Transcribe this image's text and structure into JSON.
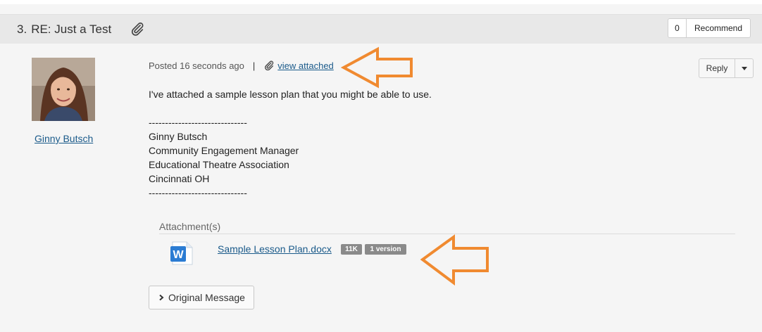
{
  "thread": {
    "number": "3.",
    "title": "RE: Just a Test",
    "recommend_count": "0",
    "recommend_label": "Recommend"
  },
  "author": {
    "name": "Ginny Butsch",
    "avatar_icon": "profile-photo"
  },
  "post": {
    "posted_text": "Posted 16 seconds ago",
    "separator": "|",
    "view_attached_label": "view attached",
    "reply_label": "Reply",
    "body_lines": [
      "I've attached a sample lesson plan that you might be able to use.",
      "",
      "------------------------------",
      "Ginny Butsch",
      "Community Engagement Manager",
      "Educational Theatre Association",
      "Cincinnati OH",
      "------------------------------"
    ]
  },
  "attachments": {
    "label": "Attachment(s)",
    "files": [
      {
        "name": "Sample Lesson Plan.docx",
        "size": "11K",
        "versions": "1 version",
        "icon": "word-doc-icon"
      }
    ]
  },
  "original_message_label": "Original Message",
  "colors": {
    "link": "#1a5a8a",
    "annotation_arrow": "#f08a30",
    "badge": "#8a8a8a",
    "header_bg": "#e8e8e8",
    "page_bg": "#f5f5f5"
  }
}
